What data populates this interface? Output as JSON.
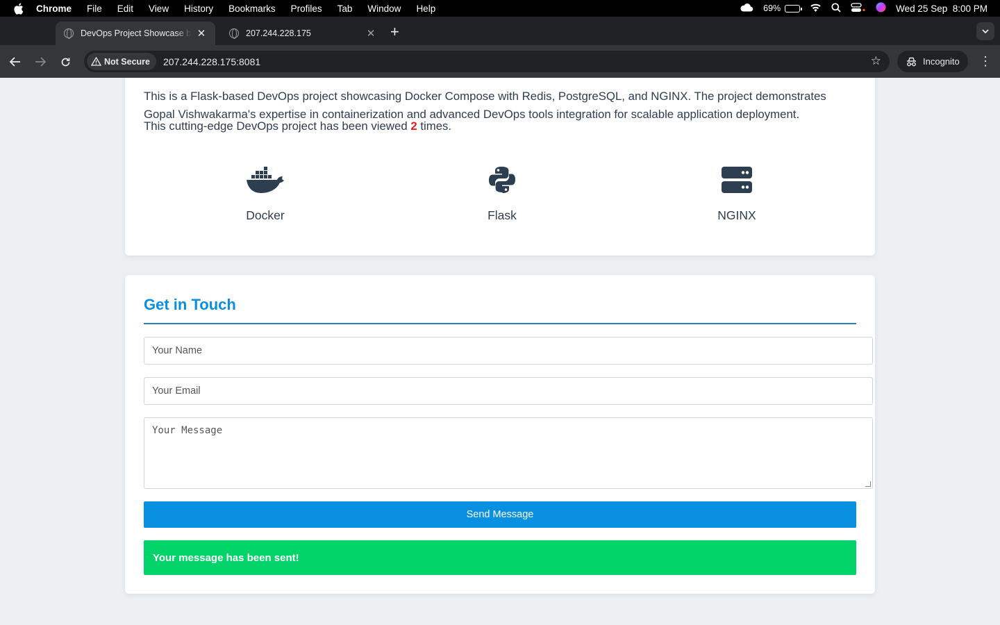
{
  "menubar": {
    "app": "Chrome",
    "items": [
      "File",
      "Edit",
      "View",
      "History",
      "Bookmarks",
      "Profiles",
      "Tab",
      "Window",
      "Help"
    ],
    "battery_pct": "69%",
    "battery_level": 0.69,
    "datetime": "Wed 25 Sep  8:00 PM"
  },
  "tabs": [
    {
      "title": "DevOps Project Showcase by",
      "active": true
    },
    {
      "title": "207.244.228.175",
      "active": false
    }
  ],
  "toolbar": {
    "security_label": "Not Secure",
    "url": "207.244.228.175:8081",
    "incognito_label": "Incognito"
  },
  "about": {
    "description": "This is a Flask-based DevOps project showcasing Docker Compose with Redis, PostgreSQL, and NGINX. The project demonstrates Gopal Vishwakarma's expertise in containerization and advanced DevOps tools integration for scalable application deployment.",
    "views_prefix": "This cutting-edge DevOps project has been viewed",
    "views_count": "2",
    "views_suffix": "times.",
    "tech": [
      {
        "name": "Docker",
        "icon": "docker-icon"
      },
      {
        "name": "Flask",
        "icon": "python-icon"
      },
      {
        "name": "NGINX",
        "icon": "server-icon"
      }
    ]
  },
  "contact": {
    "title": "Get in Touch",
    "name_placeholder": "Your Name",
    "email_placeholder": "Your Email",
    "message_placeholder": "Your Message",
    "send_label": "Send Message",
    "success_message": "Your message has been sent!"
  },
  "colors": {
    "accent": "#0a90e0",
    "success": "#02d46a",
    "view_count": "#e02020",
    "text": "#2c3e50"
  }
}
